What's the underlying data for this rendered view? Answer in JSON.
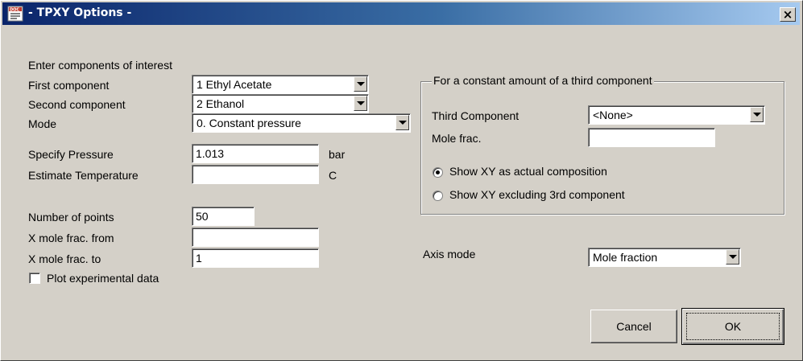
{
  "window": {
    "title": "- TPXY Options -",
    "close_label": "×"
  },
  "components": {
    "heading": "Enter components of interest",
    "first_label": "First component",
    "first_value": "1 Ethyl Acetate",
    "second_label": "Second component",
    "second_value": "2 Ethanol",
    "mode_label": "Mode",
    "mode_value": "0. Constant pressure"
  },
  "conditions": {
    "pressure_label": "Specify Pressure",
    "pressure_value": "1.013",
    "pressure_unit": "bar",
    "temperature_label": "Estimate Temperature",
    "temperature_value": "",
    "temperature_unit": "C"
  },
  "points": {
    "count_label": "Number of points",
    "count_value": "50",
    "from_label": "X mole frac. from",
    "from_value": "",
    "to_label": "X mole frac. to",
    "to_value": "1"
  },
  "plot_experimental": {
    "label": "Plot experimental data",
    "checked": false
  },
  "third_component": {
    "group_title": "For a constant amount of a third component",
    "label": "Third Component",
    "value": "<None>",
    "mole_frac_label": "Mole frac.",
    "mole_frac_value": "",
    "option_actual": "Show XY as actual composition",
    "option_excluding": "Show XY excluding 3rd component",
    "selected_option": "actual"
  },
  "axis": {
    "label": "Axis mode",
    "value": "Mole fraction"
  },
  "buttons": {
    "cancel": "Cancel",
    "ok": "OK"
  }
}
